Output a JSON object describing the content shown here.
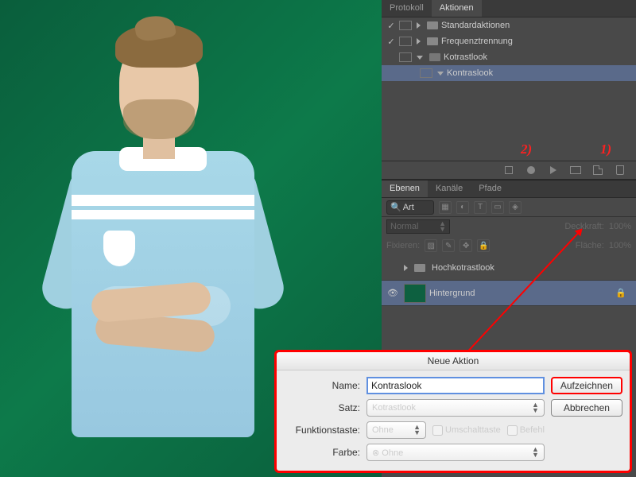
{
  "panels": {
    "history_tab": "Protokoll",
    "actions_tab": "Aktionen",
    "items": [
      {
        "label": "Standardaktionen",
        "indent": 0,
        "check": true,
        "folder": true,
        "open": false
      },
      {
        "label": "Frequenztrennung",
        "indent": 0,
        "check": true,
        "folder": true,
        "open": false
      },
      {
        "label": "Kotrastlook",
        "indent": 0,
        "check": false,
        "folder": true,
        "open": true
      },
      {
        "label": "Kontraslook",
        "indent": 1,
        "check": false,
        "folder": false,
        "open": true,
        "selected": true
      }
    ]
  },
  "annotations": {
    "one": "1)",
    "two": "2)"
  },
  "layers": {
    "tab1": "Ebenen",
    "tab2": "Kanäle",
    "tab3": "Pfade",
    "filter": "Art",
    "blend_mode": "Normal",
    "opacity_label": "Deckkraft:",
    "opacity_val": "100%",
    "lock_label": "Fixieren:",
    "fill_label": "Fläche:",
    "fill_val": "100%",
    "group1": "Hochkotrastlook",
    "bg": "Hintergrund"
  },
  "dialog": {
    "title": "Neue Aktion",
    "name_label": "Name:",
    "name_value": "Kontraslook",
    "set_label": "Satz:",
    "set_value": "Kotrastlook",
    "fn_label": "Funktionstaste:",
    "fn_value": "Ohne",
    "shift": "Umschalttaste",
    "cmd": "Befehl",
    "color_label": "Farbe:",
    "color_value": "Ohne",
    "record": "Aufzeichnen",
    "cancel": "Abbrechen"
  }
}
